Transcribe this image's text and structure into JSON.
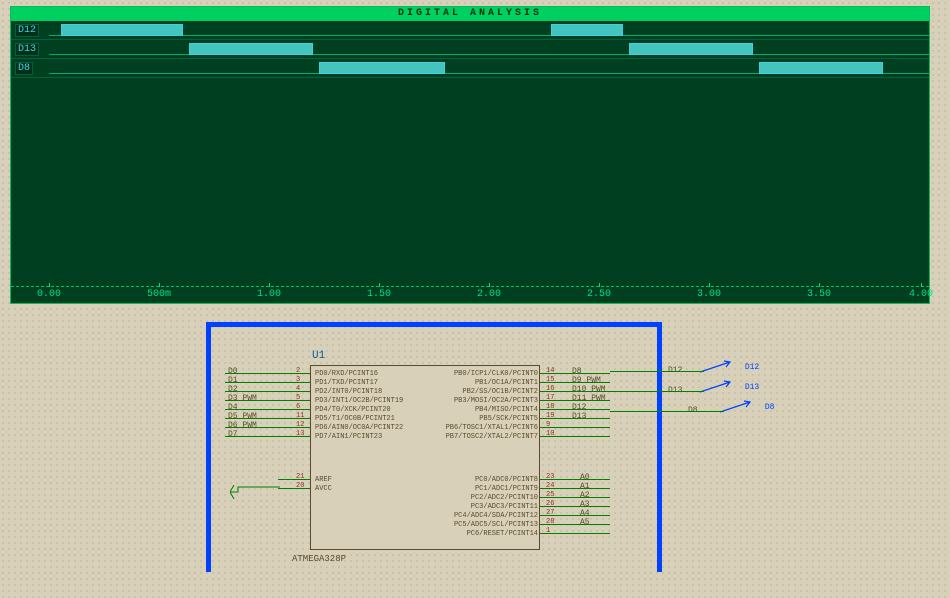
{
  "analysis": {
    "title": "DIGITAL ANALYSIS",
    "traces": [
      {
        "name": "D12",
        "pulses": [
          [
            50,
            170
          ],
          [
            540,
            610
          ]
        ]
      },
      {
        "name": "D13",
        "pulses": [
          [
            178,
            300
          ],
          [
            618,
            740
          ]
        ]
      },
      {
        "name": "D8",
        "pulses": [
          [
            308,
            432
          ],
          [
            748,
            870
          ]
        ]
      }
    ],
    "axis": [
      "0.00",
      "500m",
      "1.00",
      "1.50",
      "2.00",
      "2.50",
      "3.00",
      "3.50",
      "4.00"
    ]
  },
  "chip": {
    "ref": "U1",
    "model": "ATMEGA328P",
    "left_pins": [
      {
        "num": "2",
        "fn": "PD0/RXD/PCINT16",
        "label": "D0"
      },
      {
        "num": "3",
        "fn": "PD1/TXD/PCINT17",
        "label": "D1"
      },
      {
        "num": "4",
        "fn": "PD2/INT0/PCINT18",
        "label": "D2"
      },
      {
        "num": "5",
        "fn": "PD3/INT1/OC2B/PCINT19",
        "label": "D3_PWM"
      },
      {
        "num": "6",
        "fn": "PD4/T0/XCK/PCINT20",
        "label": "D4"
      },
      {
        "num": "11",
        "fn": "PD5/T1/OC0B/PCINT21",
        "label": "D5_PWM"
      },
      {
        "num": "12",
        "fn": "PD6/AIN0/OC0A/PCINT22",
        "label": "D6_PWM"
      },
      {
        "num": "13",
        "fn": "PD7/AIN1/PCINT23",
        "label": "D7"
      }
    ],
    "left_power": [
      {
        "num": "21",
        "fn": "AREF"
      },
      {
        "num": "20",
        "fn": "AVCC"
      }
    ],
    "right_pins_pb": [
      {
        "num": "14",
        "fn": "PB0/ICP1/CLK0/PCINT0",
        "label": "D8"
      },
      {
        "num": "15",
        "fn": "PB1/OC1A/PCINT1",
        "label": "D9_PWM"
      },
      {
        "num": "16",
        "fn": "PB2/SS/OC1B/PCINT2",
        "label": "D10_PWM"
      },
      {
        "num": "17",
        "fn": "PB3/MOSI/OC2A/PCINT3",
        "label": "D11_PWM"
      },
      {
        "num": "18",
        "fn": "PB4/MISO/PCINT4",
        "label": "D12"
      },
      {
        "num": "19",
        "fn": "PB5/SCK/PCINT5",
        "label": "D13"
      },
      {
        "num": "9",
        "fn": "PB6/TOSC1/XTAL1/PCINT6",
        "label": ""
      },
      {
        "num": "10",
        "fn": "PB7/TOSC2/XTAL2/PCINT7",
        "label": ""
      }
    ],
    "right_pins_pc": [
      {
        "num": "23",
        "fn": "PC0/ADC0/PCINT8",
        "label": "A0"
      },
      {
        "num": "24",
        "fn": "PC1/ADC1/PCINT9",
        "label": "A1"
      },
      {
        "num": "25",
        "fn": "PC2/ADC2/PCINT10",
        "label": "A2"
      },
      {
        "num": "26",
        "fn": "PC3/ADC3/PCINT11",
        "label": "A3"
      },
      {
        "num": "27",
        "fn": "PC4/ADC4/SDA/PCINT12",
        "label": "A4"
      },
      {
        "num": "28",
        "fn": "PC5/ADC5/SCL/PCINT13",
        "label": "A5"
      },
      {
        "num": "1",
        "fn": "PC6/RESET/PCINT14",
        "label": ""
      }
    ]
  },
  "probes": [
    {
      "name": "D12",
      "label": "D12"
    },
    {
      "name": "D13",
      "label": "D13"
    },
    {
      "name": "D8",
      "label": "D8"
    }
  ],
  "probe_nets": [
    "D12",
    "D13",
    "D8"
  ]
}
